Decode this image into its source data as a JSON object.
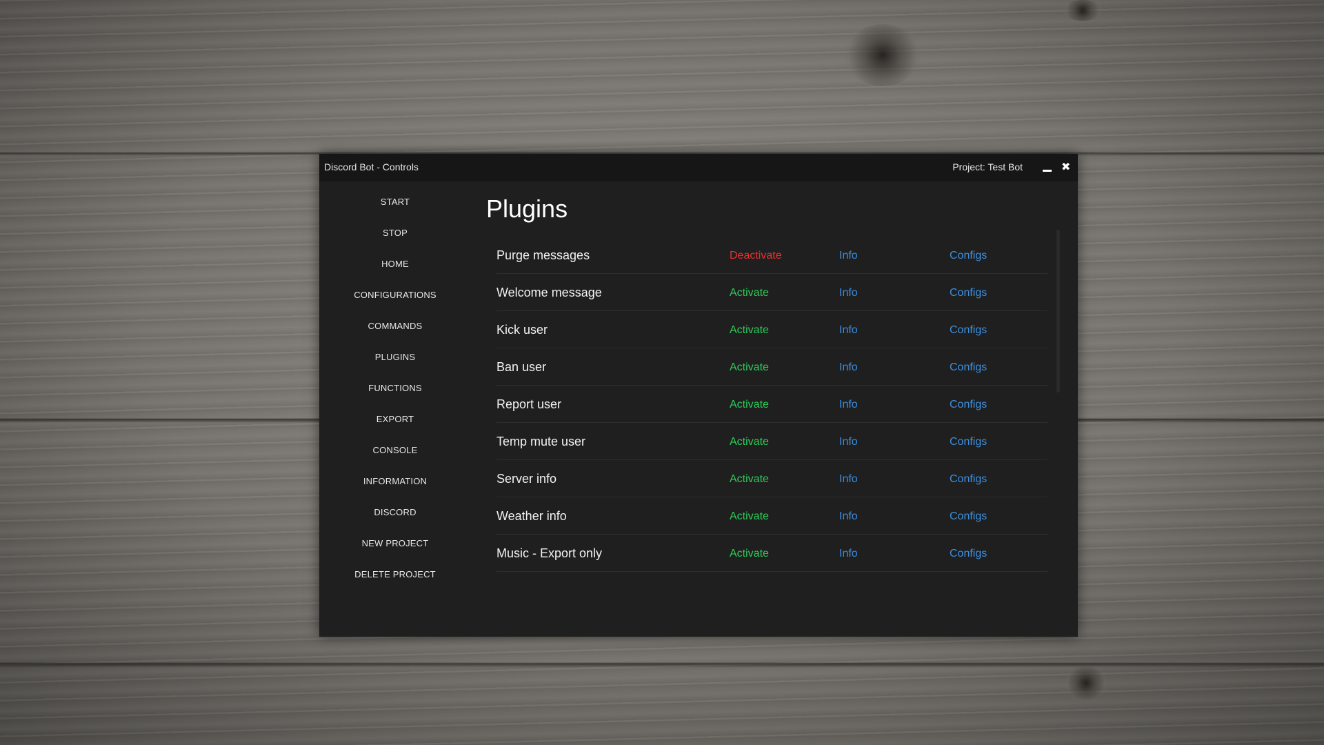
{
  "window": {
    "title": "Discord Bot - Controls",
    "project_label": "Project: Test Bot",
    "minimize_icon": "minimize-icon",
    "close_icon": "close-icon",
    "close_glyph": "✖"
  },
  "sidebar": {
    "items": [
      {
        "label": "START"
      },
      {
        "label": "STOP"
      },
      {
        "label": "HOME"
      },
      {
        "label": "CONFIGURATIONS"
      },
      {
        "label": "COMMANDS"
      },
      {
        "label": "PLUGINS"
      },
      {
        "label": "FUNCTIONS"
      },
      {
        "label": "EXPORT"
      },
      {
        "label": "CONSOLE"
      },
      {
        "label": "INFORMATION"
      },
      {
        "label": "DISCORD"
      },
      {
        "label": "NEW PROJECT"
      },
      {
        "label": "DELETE PROJECT"
      }
    ]
  },
  "main": {
    "title": "Plugins",
    "info_label": "Info",
    "configs_label": "Configs",
    "plugins": [
      {
        "name": "Purge messages",
        "action": "Deactivate",
        "active": true
      },
      {
        "name": "Welcome message",
        "action": "Activate",
        "active": false
      },
      {
        "name": "Kick user",
        "action": "Activate",
        "active": false
      },
      {
        "name": "Ban user",
        "action": "Activate",
        "active": false
      },
      {
        "name": "Report user",
        "action": "Activate",
        "active": false
      },
      {
        "name": "Temp mute user",
        "action": "Activate",
        "active": false
      },
      {
        "name": "Server info",
        "action": "Activate",
        "active": false
      },
      {
        "name": "Weather info",
        "action": "Activate",
        "active": false
      },
      {
        "name": "Music - Export only",
        "action": "Activate",
        "active": false
      }
    ]
  },
  "colors": {
    "window_bg": "#1f1f1f",
    "titlebar_bg": "#161616",
    "activate": "#2ecc5a",
    "deactivate": "#e8322e",
    "link": "#3d8fe0"
  }
}
